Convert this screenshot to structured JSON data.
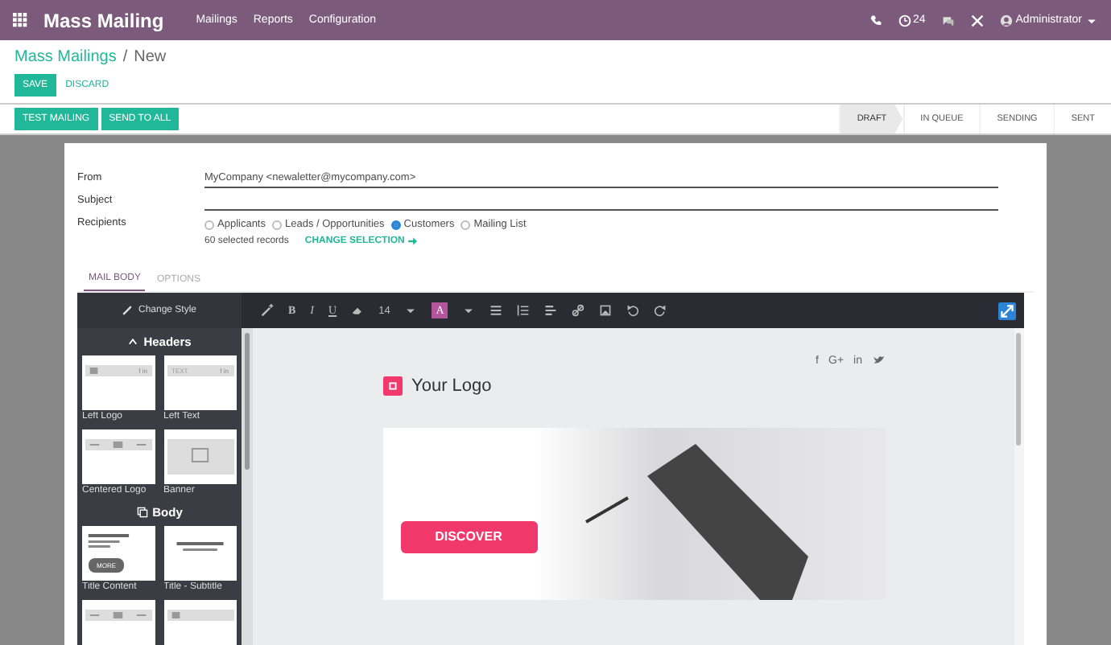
{
  "navbar": {
    "app_title": "Mass Mailing",
    "menu": [
      {
        "label": "Mailings"
      },
      {
        "label": "Reports"
      },
      {
        "label": "Configuration"
      }
    ],
    "notifications_count": "24",
    "user": "Administrator"
  },
  "breadcrumb": {
    "parent": "Mass Mailings",
    "separator": "/",
    "current": "New"
  },
  "actions": {
    "save": "SAVE",
    "discard": "DISCARD"
  },
  "buttons": [
    "TEST MAILING",
    "SEND TO ALL"
  ],
  "stages": [
    {
      "label": "DRAFT",
      "selected": true
    },
    {
      "label": "IN QUEUE",
      "selected": false
    },
    {
      "label": "SENDING",
      "selected": false
    },
    {
      "label": "SENT",
      "selected": false
    }
  ],
  "form": {
    "from": {
      "label": "From",
      "value": "MyCompany <newaletter@mycompany.com>"
    },
    "subject": {
      "label": "Subject"
    },
    "recipients": {
      "label": "Recipients",
      "options": [
        {
          "label": "Applicants",
          "selected": false
        },
        {
          "label": "Leads / Opportunities",
          "selected": false
        },
        {
          "label": "Customers",
          "selected": true
        },
        {
          "label": "Mailing List",
          "selected": false
        }
      ],
      "count_text": "60 selected records",
      "change_link": "CHANGE SELECTION"
    }
  },
  "tabs": [
    {
      "label": "MAIL BODY",
      "selected": true
    },
    {
      "label": "OPTIONS",
      "selected": false
    }
  ],
  "editor": {
    "change_style": "Change Style",
    "format_buttons": [
      "B",
      "I",
      "U"
    ],
    "font_size": "14",
    "color_letter": "A",
    "sections": [
      {
        "kind": "headers",
        "title": "Headers",
        "snippets": [
          {
            "kind": "left-logo",
            "label": "Left Logo",
            "social_text": "f in"
          },
          {
            "kind": "left-text",
            "label": "Left Text",
            "thumb_text": "TEXT",
            "social_text": "f in"
          },
          {
            "kind": "centered-logo",
            "label": "Centered Logo"
          },
          {
            "kind": "banner",
            "label": "Banner"
          }
        ]
      },
      {
        "kind": "body",
        "title": "Body",
        "snippets": [
          {
            "kind": "title-content",
            "label": "Title Content",
            "thumb_text": "MORE"
          },
          {
            "kind": "title-subtitle",
            "label": "Title - Subtitle"
          },
          {
            "kind": "centered-logo"
          },
          {
            "kind": "left-logo"
          }
        ]
      }
    ],
    "canvas": {
      "social": [
        "f",
        "G+",
        "in"
      ],
      "logo_text": "Your Logo",
      "banner_button": "DISCOVER"
    }
  }
}
